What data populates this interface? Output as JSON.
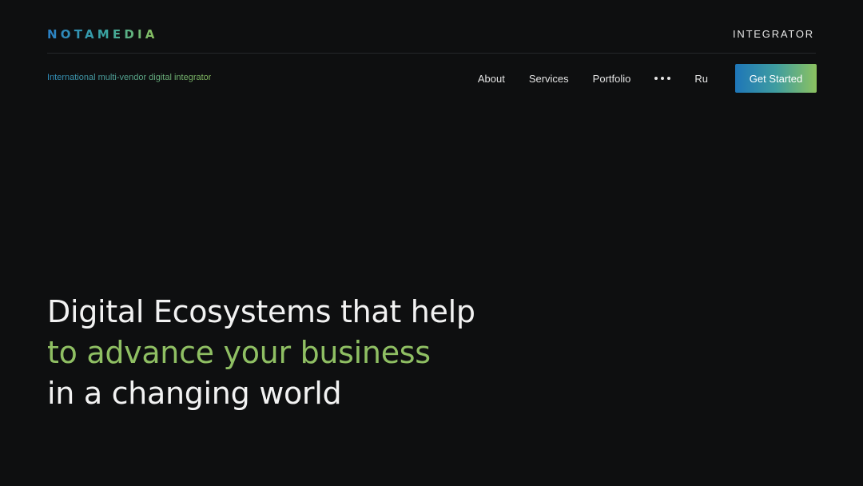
{
  "header": {
    "logo": "NOTAMEDIA",
    "right_label": "INTEGRATOR"
  },
  "navrow": {
    "tagline": "International multi-vendor digital integrator",
    "links": [
      "About",
      "Services",
      "Portfolio"
    ],
    "more_icon": "more-horizontal-icon",
    "language": "Ru",
    "cta_label": "Get Started"
  },
  "hero": {
    "line1": "Digital Ecosystems that help",
    "line2": "to advance your business",
    "line3": "in a changing world"
  },
  "colors": {
    "background": "#0e0f10",
    "accent_green": "#8fbf63",
    "accent_blue": "#1e76b8"
  }
}
